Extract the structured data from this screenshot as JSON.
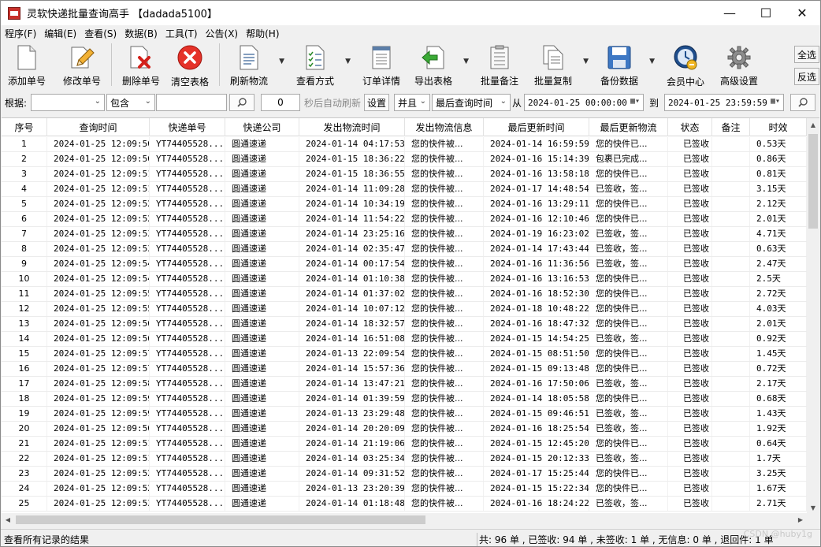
{
  "window": {
    "title": "灵软快递批量查询高手 【dadada5100】",
    "controls": [
      "minimize-icon",
      "maximize-icon",
      "close-icon"
    ]
  },
  "menu": [
    "程序(F)",
    "编辑(E)",
    "查看(S)",
    "数据(B)",
    "工具(T)",
    "公告(X)",
    "帮助(H)"
  ],
  "toolbar": {
    "add": "添加单号",
    "edit": "修改单号",
    "delete": "删除单号",
    "clear": "清空表格",
    "refresh": "刷新物流",
    "view_mode": "查看方式",
    "detail": "订单详情",
    "export": "导出表格",
    "batch_note": "批量备注",
    "batch_copy": "批量复制",
    "backup": "备份数据",
    "member": "会员中心",
    "settings": "高级设置",
    "select_all": "全选",
    "invert": "反选"
  },
  "filter": {
    "basis_label": "根据:",
    "basis_value": "",
    "match_value": "包含",
    "keyword": "",
    "interval": "0",
    "interval_label": "秒后自动刷新",
    "set_label": "设置",
    "logic": "并且",
    "time_field": "最后查询时间",
    "from_label": "从",
    "from_value": "2024-01-25 00:00:00",
    "to_label": "到",
    "to_value": "2024-01-25 23:59:59"
  },
  "columns": [
    "序号",
    "查询时间",
    "快递单号",
    "快递公司",
    "发出物流时间",
    "发出物流信息",
    "最后更新时间",
    "最后更新物流",
    "状态",
    "备注",
    "时效"
  ],
  "rows": [
    [
      "1",
      "2024-01-25 12:09:50",
      "YT74405528...",
      "圆通速递",
      "2024-01-14 04:17:53",
      "您的快件被...",
      "2024-01-14 16:59:59",
      "您的快件已...",
      "已签收",
      "",
      "0.53天"
    ],
    [
      "2",
      "2024-01-25 12:09:50",
      "YT74405528...",
      "圆通速递",
      "2024-01-15 18:36:22",
      "您的快件被...",
      "2024-01-16 15:14:39",
      "包裹已完成...",
      "已签收",
      "",
      "0.86天"
    ],
    [
      "3",
      "2024-01-25 12:09:51",
      "YT74405528...",
      "圆通速递",
      "2024-01-15 18:36:55",
      "您的快件被...",
      "2024-01-16 13:58:18",
      "您的快件已...",
      "已签收",
      "",
      "0.81天"
    ],
    [
      "4",
      "2024-01-25 12:09:51",
      "YT74405528...",
      "圆通速递",
      "2024-01-14 11:09:28",
      "您的快件被...",
      "2024-01-17 14:48:54",
      "已签收，签...",
      "已签收",
      "",
      "3.15天"
    ],
    [
      "5",
      "2024-01-25 12:09:52",
      "YT74405528...",
      "圆通速递",
      "2024-01-14 10:34:19",
      "您的快件被...",
      "2024-01-16 13:29:11",
      "您的快件已...",
      "已签收",
      "",
      "2.12天"
    ],
    [
      "6",
      "2024-01-25 12:09:52",
      "YT74405528...",
      "圆通速递",
      "2024-01-14 11:54:22",
      "您的快件被...",
      "2024-01-16 12:10:46",
      "您的快件已...",
      "已签收",
      "",
      "2.01天"
    ],
    [
      "7",
      "2024-01-25 12:09:53",
      "YT74405528...",
      "圆通速递",
      "2024-01-14 23:25:16",
      "您的快件被...",
      "2024-01-19 16:23:02",
      "已签收，签...",
      "已签收",
      "",
      "4.71天"
    ],
    [
      "8",
      "2024-01-25 12:09:53",
      "YT74405528...",
      "圆通速递",
      "2024-01-14 02:35:47",
      "您的快件被...",
      "2024-01-14 17:43:44",
      "已签收，签...",
      "已签收",
      "",
      "0.63天"
    ],
    [
      "9",
      "2024-01-25 12:09:54",
      "YT74405528...",
      "圆通速递",
      "2024-01-14 00:17:54",
      "您的快件被...",
      "2024-01-16 11:36:56",
      "已签收，签...",
      "已签收",
      "",
      "2.47天"
    ],
    [
      "10",
      "2024-01-25 12:09:54",
      "YT74405528...",
      "圆通速递",
      "2024-01-14 01:10:38",
      "您的快件被...",
      "2024-01-16 13:16:53",
      "您的快件已...",
      "已签收",
      "",
      "2.5天"
    ],
    [
      "11",
      "2024-01-25 12:09:55",
      "YT74405528...",
      "圆通速递",
      "2024-01-14 01:37:02",
      "您的快件被...",
      "2024-01-16 18:52:30",
      "您的快件已...",
      "已签收",
      "",
      "2.72天"
    ],
    [
      "12",
      "2024-01-25 12:09:55",
      "YT74405528...",
      "圆通速递",
      "2024-01-14 10:07:12",
      "您的快件被...",
      "2024-01-18 10:48:22",
      "您的快件已...",
      "已签收",
      "",
      "4.03天"
    ],
    [
      "13",
      "2024-01-25 12:09:56",
      "YT74405528...",
      "圆通速递",
      "2024-01-14 18:32:57",
      "您的快件被...",
      "2024-01-16 18:47:32",
      "您的快件已...",
      "已签收",
      "",
      "2.01天"
    ],
    [
      "14",
      "2024-01-25 12:09:56",
      "YT74405528...",
      "圆通速递",
      "2024-01-14 16:51:08",
      "您的快件被...",
      "2024-01-15 14:54:25",
      "已签收，签...",
      "已签收",
      "",
      "0.92天"
    ],
    [
      "15",
      "2024-01-25 12:09:57",
      "YT74405528...",
      "圆通速递",
      "2024-01-13 22:09:54",
      "您的快件被...",
      "2024-01-15 08:51:50",
      "您的快件已...",
      "已签收",
      "",
      "1.45天"
    ],
    [
      "16",
      "2024-01-25 12:09:57",
      "YT74405528...",
      "圆通速递",
      "2024-01-14 15:57:36",
      "您的快件被...",
      "2024-01-15 09:13:48",
      "您的快件已...",
      "已签收",
      "",
      "0.72天"
    ],
    [
      "17",
      "2024-01-25 12:09:58",
      "YT74405528...",
      "圆通速递",
      "2024-01-14 13:47:21",
      "您的快件被...",
      "2024-01-16 17:50:06",
      "已签收，签...",
      "已签收",
      "",
      "2.17天"
    ],
    [
      "18",
      "2024-01-25 12:09:59",
      "YT74405528...",
      "圆通速递",
      "2024-01-14 01:39:59",
      "您的快件被...",
      "2024-01-14 18:05:58",
      "您的快件已...",
      "已签收",
      "",
      "0.68天"
    ],
    [
      "19",
      "2024-01-25 12:09:59",
      "YT74405528...",
      "圆通速递",
      "2024-01-13 23:29:48",
      "您的快件被...",
      "2024-01-15 09:46:51",
      "已签收，签...",
      "已签收",
      "",
      "1.43天"
    ],
    [
      "20",
      "2024-01-25 12:09:50",
      "YT74405528...",
      "圆通速递",
      "2024-01-14 20:20:09",
      "您的快件被...",
      "2024-01-16 18:25:54",
      "已签收，签...",
      "已签收",
      "",
      "1.92天"
    ],
    [
      "21",
      "2024-01-25 12:09:51",
      "YT74405528...",
      "圆通速递",
      "2024-01-14 21:19:06",
      "您的快件被...",
      "2024-01-15 12:45:20",
      "您的快件已...",
      "已签收",
      "",
      "0.64天"
    ],
    [
      "22",
      "2024-01-25 12:09:51",
      "YT74405528...",
      "圆通速递",
      "2024-01-14 03:25:34",
      "您的快件被...",
      "2024-01-15 20:12:33",
      "已签收，签...",
      "已签收",
      "",
      "1.7天"
    ],
    [
      "23",
      "2024-01-25 12:09:52",
      "YT74405528...",
      "圆通速递",
      "2024-01-14 09:31:52",
      "您的快件被...",
      "2024-01-17 15:25:44",
      "您的快件已...",
      "已签收",
      "",
      "3.25天"
    ],
    [
      "24",
      "2024-01-25 12:09:52",
      "YT74405528...",
      "圆通速递",
      "2024-01-13 23:20:39",
      "您的快件被...",
      "2024-01-15 15:22:34",
      "您的快件已...",
      "已签收",
      "",
      "1.67天"
    ],
    [
      "25",
      "2024-01-25 12:09:53",
      "YT74405528...",
      "圆通速递",
      "2024-01-14 01:18:48",
      "您的快件被...",
      "2024-01-16 18:24:22",
      "已签收，签...",
      "已签收",
      "",
      "2.71天"
    ]
  ],
  "status": {
    "left": "查看所有记录的结果",
    "right": "共: 96 单 , 已签收: 94 单 , 未签收: 1 单 , 无信息: 0 单 , 退回件: 1 单"
  },
  "watermark": "CSDN @huby1g"
}
